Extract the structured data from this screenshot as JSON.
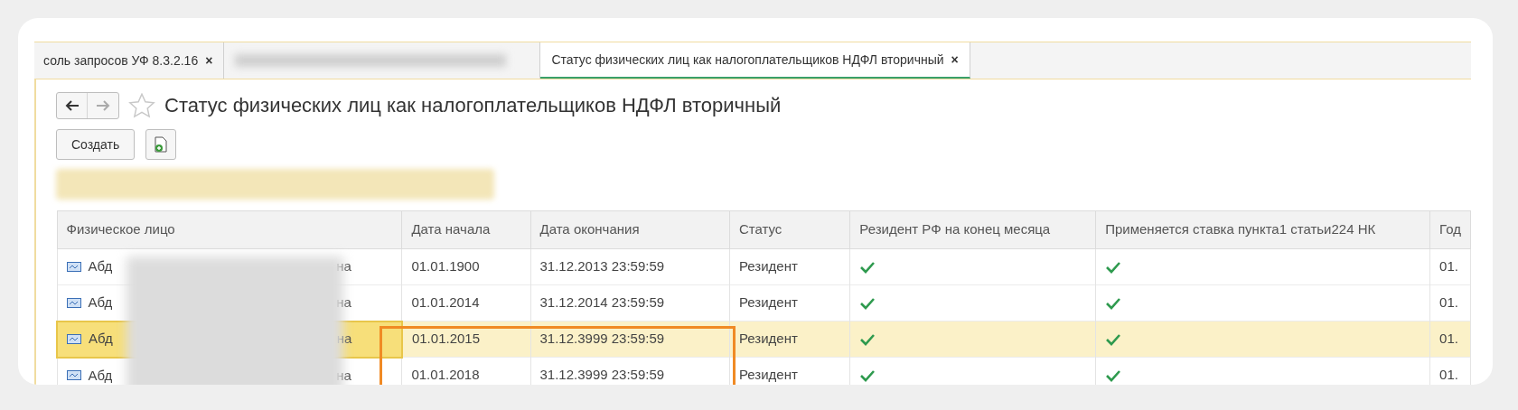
{
  "tabs": [
    {
      "label": "соль запросов УФ 8.3.2.16",
      "close": "×",
      "selected": false,
      "kind": "text"
    },
    {
      "kind": "blurred",
      "selected": false
    },
    {
      "label": "Статус физических лиц как налогоплательщиков НДФЛ вторичный",
      "close": "×",
      "selected": true,
      "kind": "text"
    }
  ],
  "form": {
    "title": "Статус физических лиц как налогоплательщиков НДФЛ вторичный",
    "favorite": false,
    "create_button": "Создать"
  },
  "table": {
    "columns": [
      "Физическое лицо",
      "Дата начала",
      "Дата окончания",
      "Статус",
      "Резидент РФ на конец месяца",
      "Применяется ставка пункта1 статьи224 НК",
      "Год"
    ],
    "rows": [
      {
        "name_start": "Абд",
        "name_end": "на",
        "start": "01.01.1900",
        "end": "31.12.2013 23:59:59",
        "status": "Резидент",
        "resident": true,
        "rate": true,
        "column_7": "01.",
        "selected": false
      },
      {
        "name_start": "Абд",
        "name_end": "на",
        "start": "01.01.2014",
        "end": "31.12.2014 23:59:59",
        "status": "Резидент",
        "resident": true,
        "rate": true,
        "column_7": "01.",
        "selected": false
      },
      {
        "name_start": "Абд",
        "name_end": "на",
        "start": "01.01.2015",
        "end": "31.12.3999 23:59:59",
        "status": "Резидент",
        "resident": true,
        "rate": true,
        "column_7": "01.",
        "selected": true
      },
      {
        "name_start": "Абд",
        "name_end": "на",
        "start": "01.01.2018",
        "end": "31.12.3999 23:59:59",
        "status": "Резидент",
        "resident": true,
        "rate": true,
        "column_7": "01.",
        "selected": false
      }
    ]
  }
}
